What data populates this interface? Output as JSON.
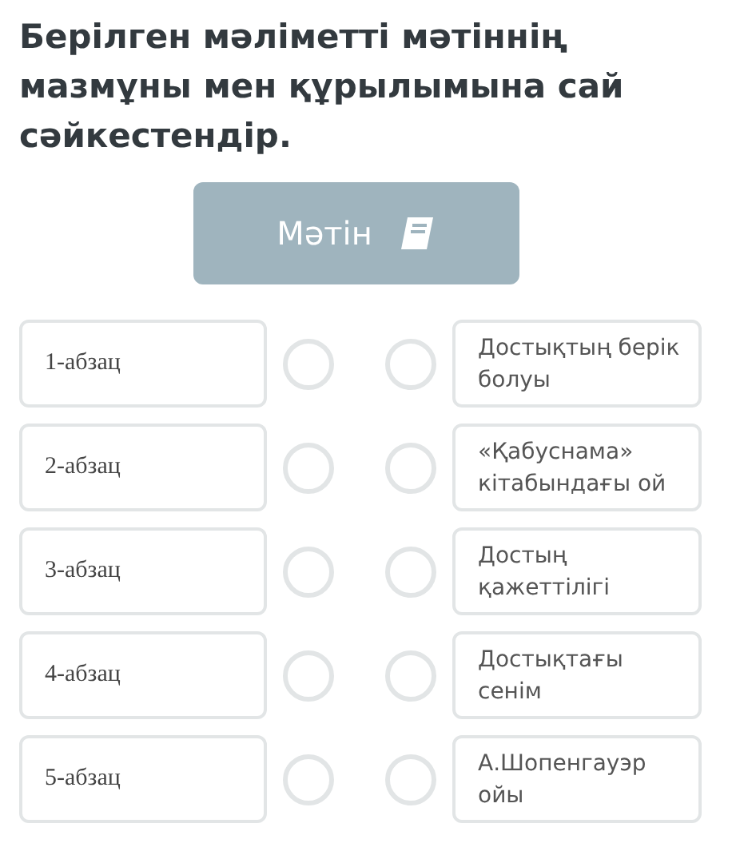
{
  "title": "Берілген мәліметті мәтіннің мазмұны мен құрылымына сай сәйкестендір.",
  "text_button": {
    "label": "Мәтін"
  },
  "pairs": [
    {
      "left": "1-абзац",
      "right": "Достықтың берік болуы"
    },
    {
      "left": "2-абзац",
      "right": "«Қабуснама» кітабындағы ой"
    },
    {
      "left": "3-абзац",
      "right": "Достың қажеттілігі"
    },
    {
      "left": "4-абзац",
      "right": "Достықтағы сенім"
    },
    {
      "left": "5-абзац",
      "right": "А.Шопенгауэр ойы"
    }
  ]
}
